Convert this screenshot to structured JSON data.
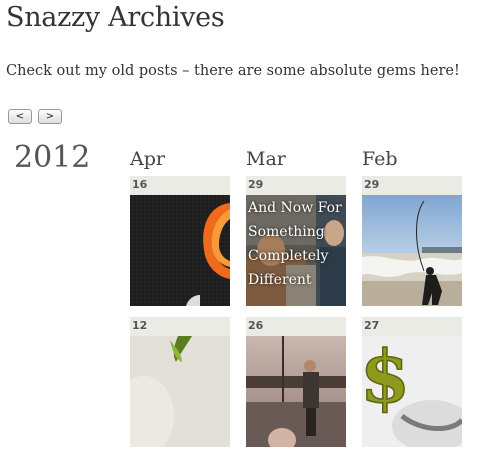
{
  "header": {
    "title": "Snazzy Archives",
    "intro": "Check out my old posts – there are some absolute gems here!"
  },
  "nav": {
    "prev_label": "<",
    "next_label": ">"
  },
  "archive": {
    "year": "2012",
    "months": [
      "Apr",
      "Mar",
      "Feb"
    ],
    "posts": [
      {
        "day": "16",
        "overlay": "",
        "thumb": "orange-swirl-icon"
      },
      {
        "day": "29",
        "overlay": "And Now For Something Completely Different",
        "thumb": "people-photo"
      },
      {
        "day": "29",
        "overlay": "",
        "thumb": "beach-fishing-photo"
      },
      {
        "day": "12",
        "overlay": "",
        "thumb": "green-leaf-graphic"
      },
      {
        "day": "26",
        "overlay": "",
        "thumb": "evening-street-photo"
      },
      {
        "day": "27",
        "overlay": "",
        "thumb": "dollar-sign-graphic"
      }
    ]
  },
  "colors": {
    "tile_bg": "#ebebe6",
    "text": "#333333"
  }
}
